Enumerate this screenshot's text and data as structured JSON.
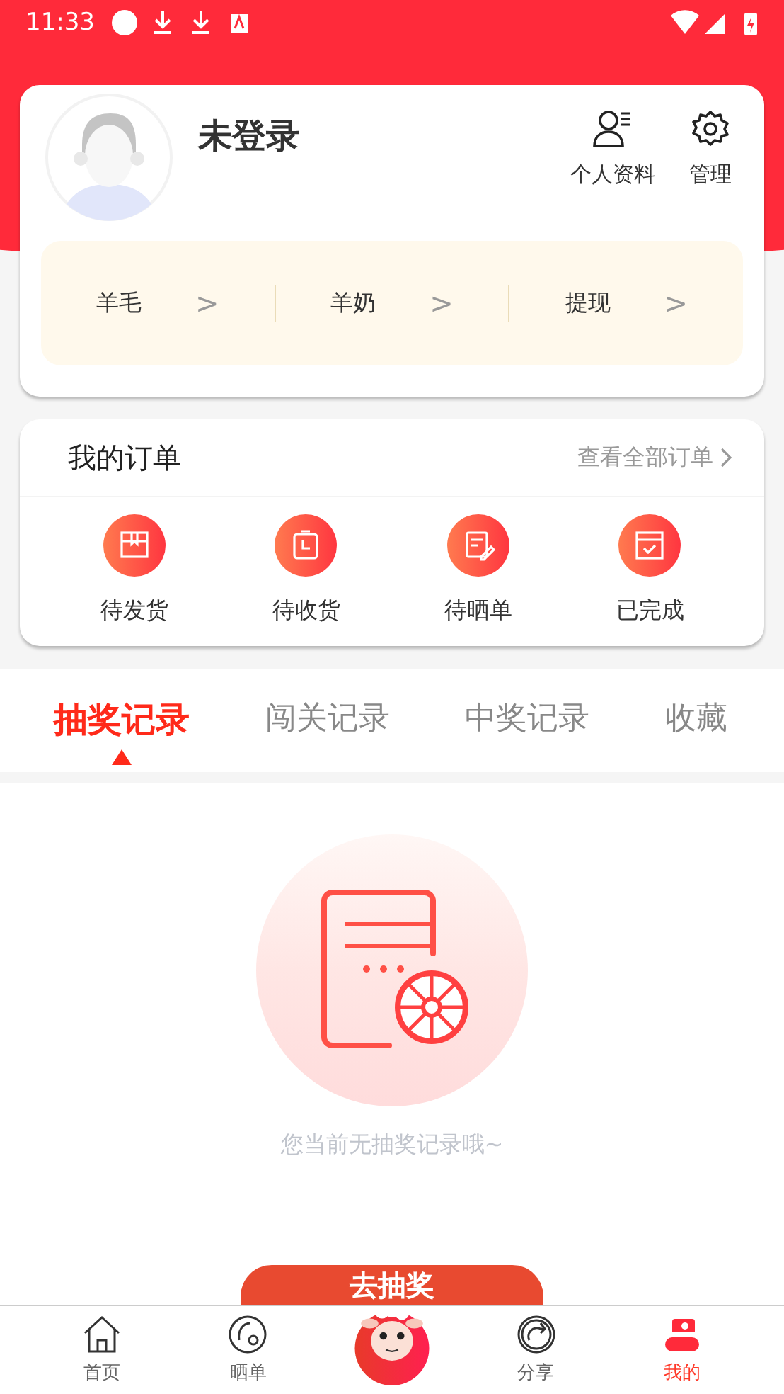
{
  "status_bar": {
    "time": "11:33"
  },
  "profile": {
    "name": "未登录",
    "actions": [
      {
        "kind": "profile",
        "label": "个人资料"
      },
      {
        "kind": "settings",
        "label": "管理"
      }
    ],
    "wallet": [
      {
        "label": "羊毛",
        "arrow": ">"
      },
      {
        "label": "羊奶",
        "arrow": ">"
      },
      {
        "label": "提现",
        "arrow": ">"
      }
    ]
  },
  "orders": {
    "title": "我的订单",
    "view_all": "查看全部订单",
    "items": [
      {
        "kind": "box",
        "label": "待发货"
      },
      {
        "kind": "clock",
        "label": "待收货"
      },
      {
        "kind": "note",
        "label": "待晒单"
      },
      {
        "kind": "check",
        "label": "已完成"
      }
    ]
  },
  "tabs": [
    {
      "label": "抽奖记录",
      "selected": true
    },
    {
      "label": "闯关记录",
      "selected": false
    },
    {
      "label": "中奖记录",
      "selected": false
    },
    {
      "label": "收藏",
      "selected": false
    }
  ],
  "empty": {
    "message": "您当前无抽奖记录哦~"
  },
  "draw_button": {
    "label": "去抽奖"
  },
  "nav": [
    {
      "kind": "home",
      "label": "首页",
      "selected": false
    },
    {
      "kind": "show",
      "label": "晒单",
      "selected": false
    },
    {
      "kind": "mascot",
      "selected": false
    },
    {
      "kind": "share",
      "label": "分享",
      "selected": false
    },
    {
      "kind": "me",
      "label": "我的",
      "selected": true
    }
  ]
}
